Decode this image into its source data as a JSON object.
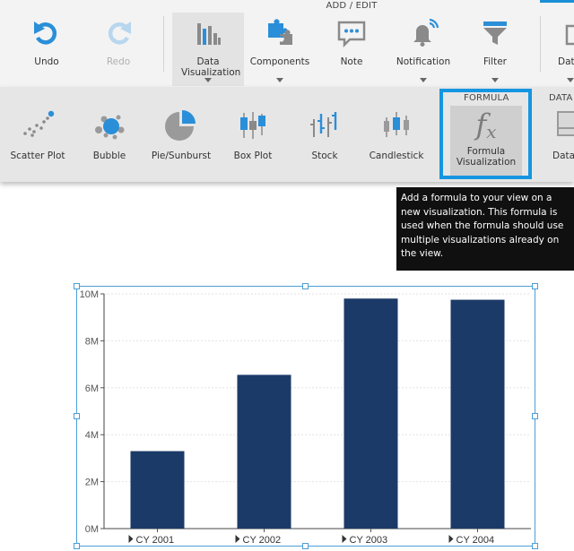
{
  "ribbon": {
    "group_title": "ADD / EDIT",
    "buttons": [
      {
        "id": "undo",
        "label": "Undo",
        "icon": "undo-icon"
      },
      {
        "id": "redo",
        "label": "Redo",
        "icon": "redo-icon",
        "disabled": true
      },
      {
        "id": "data-visualization",
        "label": "Data Visualization",
        "icon": "bar-chart-icon",
        "active": true
      },
      {
        "id": "components",
        "label": "Components",
        "icon": "puzzle-icon"
      },
      {
        "id": "note",
        "label": "Note",
        "icon": "note-icon"
      },
      {
        "id": "notification",
        "label": "Notification",
        "icon": "bell-icon"
      },
      {
        "id": "filter",
        "label": "Filter",
        "icon": "filter-icon"
      },
      {
        "id": "data-cut",
        "label": "Data",
        "icon": "data-icon"
      }
    ]
  },
  "subribbon": {
    "items": [
      {
        "label": "Scatter Plot",
        "icon": "scatter-plot-icon"
      },
      {
        "label": "Bubble",
        "icon": "bubble-icon"
      },
      {
        "label": "Pie/Sunburst",
        "icon": "pie-icon"
      },
      {
        "label": "Box Plot",
        "icon": "box-plot-icon"
      },
      {
        "label": "Stock",
        "icon": "stock-icon"
      },
      {
        "label": "Candlestick",
        "icon": "candlestick-icon"
      }
    ],
    "formula_section": "FORMULA",
    "formula_button": {
      "label": "Formula Visualization",
      "icon": "formula-fx-icon"
    },
    "data_section": "DATA",
    "data_button": {
      "label": "Data"
    }
  },
  "tooltip": {
    "text": "Add a formula to your view on a new visualization. This formula is used when the formula should use multiple visualizations already on the view."
  },
  "colors": {
    "accent": "#1596e0",
    "bar": "#1b3a68",
    "icon_blue": "#2a8fd8",
    "icon_gray": "#8a8a8a"
  },
  "chart_data": {
    "type": "bar",
    "categories": [
      "CY 2001",
      "CY 2002",
      "CY 2003",
      "CY 2004"
    ],
    "values": [
      3300000,
      6550000,
      9800000,
      9750000
    ],
    "ylim": [
      0,
      10000000
    ],
    "yticks": [
      0,
      2000000,
      4000000,
      6000000,
      8000000,
      10000000
    ],
    "ytick_labels": [
      "0M",
      "2M",
      "4M",
      "6M",
      "8M",
      "10M"
    ],
    "grid": true
  }
}
